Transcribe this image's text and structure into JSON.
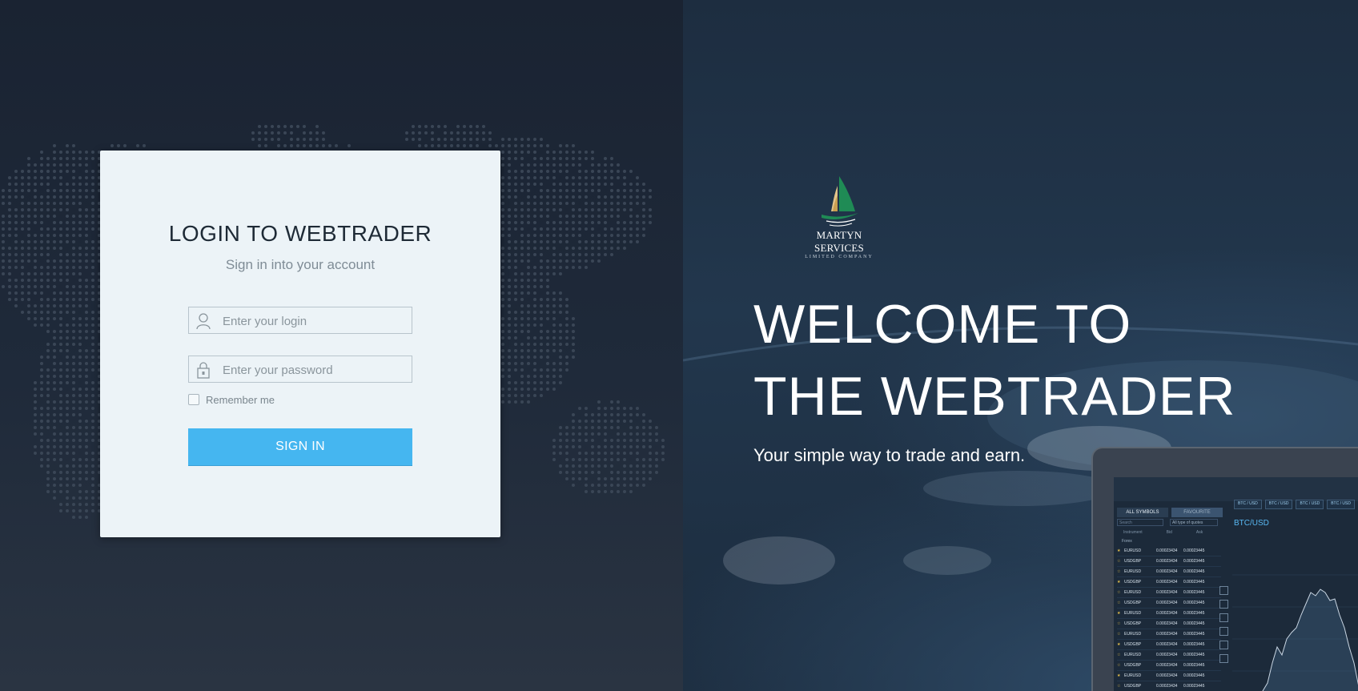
{
  "login": {
    "title": "LOGIN TO WEBTRADER",
    "subtitle": "Sign in into your account",
    "login_placeholder": "Enter your login",
    "password_placeholder": "Enter your password",
    "remember_label": "Remember me",
    "sign_in_label": "SIGN IN",
    "accent_color": "#45b6f0"
  },
  "brand": {
    "name": "MARTYN SERVICES",
    "sub": "LIMITED COMPANY",
    "logo_icon": "sailboat-logo-icon"
  },
  "hero": {
    "welcome": "WELCOME TO THE WEBTRADER",
    "tagline": "Your simple way to trade and earn."
  },
  "laptop": {
    "tab_all": "ALL SYMBOLS",
    "tab_fav": "FAVOURITE",
    "symbol_tabs": [
      "BTC / USD",
      "BTC / USD",
      "BTC / USD",
      "BTC / USD"
    ],
    "search_placeholder": "Search",
    "select_value": "All type of quotes",
    "columns": [
      "Instrument",
      "Bid",
      "Ask"
    ],
    "group": "Forex",
    "pair": "BTC/USD",
    "rows": [
      {
        "symbol": "EURUSD",
        "bid": "0.00023434",
        "ask": "0.00023445"
      },
      {
        "symbol": "USDGBP",
        "bid": "0.00023434",
        "ask": "0.00023445"
      },
      {
        "symbol": "EURUSD",
        "bid": "0.00023434",
        "ask": "0.00023445"
      },
      {
        "symbol": "USDGBP",
        "bid": "0.00023434",
        "ask": "0.00023445"
      },
      {
        "symbol": "EURUSD",
        "bid": "0.00023434",
        "ask": "0.00023445"
      },
      {
        "symbol": "USDGBP",
        "bid": "0.00023434",
        "ask": "0.00023445"
      },
      {
        "symbol": "EURUSD",
        "bid": "0.00023434",
        "ask": "0.00023445"
      },
      {
        "symbol": "USDGBP",
        "bid": "0.00023434",
        "ask": "0.00023445"
      },
      {
        "symbol": "EURUSD",
        "bid": "0.00023434",
        "ask": "0.00023445"
      },
      {
        "symbol": "USDGBP",
        "bid": "0.00023434",
        "ask": "0.00023445"
      },
      {
        "symbol": "EURUSD",
        "bid": "0.00023434",
        "ask": "0.00023445"
      },
      {
        "symbol": "USDGBP",
        "bid": "0.00023434",
        "ask": "0.00023445"
      },
      {
        "symbol": "EURUSD",
        "bid": "0.00023434",
        "ask": "0.00023445"
      },
      {
        "symbol": "USDGBP",
        "bid": "0.00023434",
        "ask": "0.00023445"
      },
      {
        "symbol": "EURUSD",
        "bid": "0.00023434",
        "ask": "0.00023445"
      }
    ]
  }
}
